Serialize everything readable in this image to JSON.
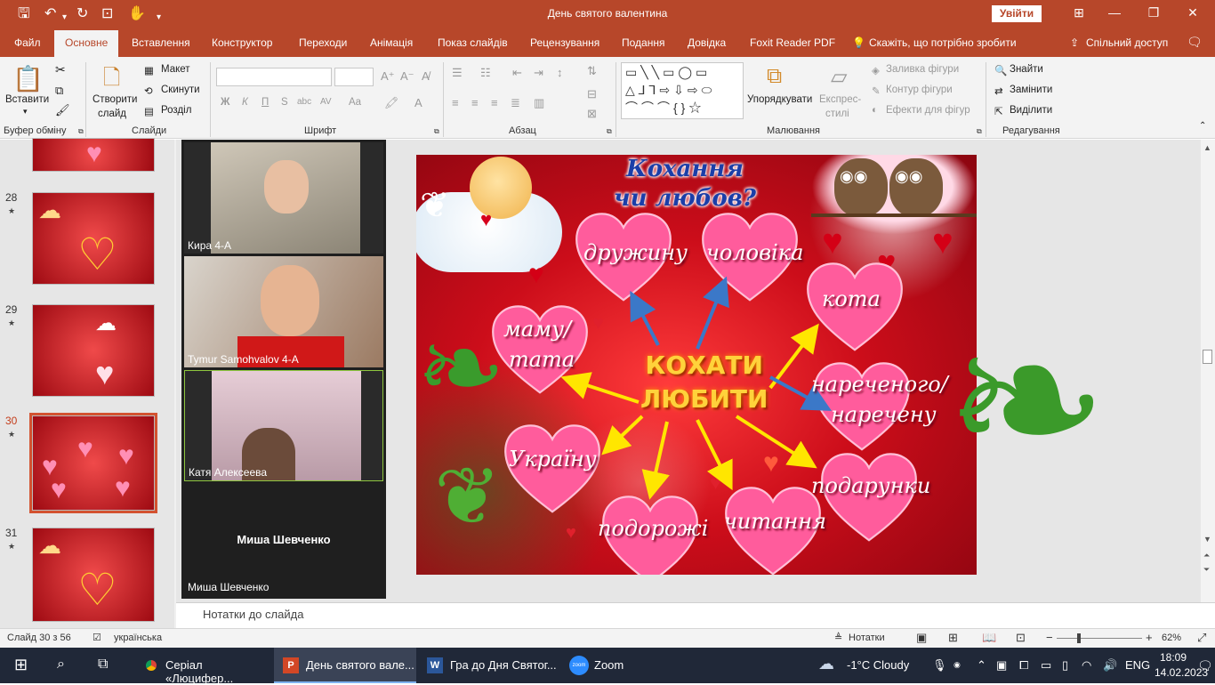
{
  "window": {
    "title": "День святого валентина",
    "signin": "Увійти"
  },
  "tabs": [
    "Файл",
    "Основне",
    "Вставлення",
    "Конструктор",
    "Переходи",
    "Анімація",
    "Показ слайдів",
    "Рецензування",
    "Подання",
    "Довідка",
    "Foxit Reader PDF"
  ],
  "tell_me": "Скажіть, що потрібно зробити",
  "share": "Спільний доступ",
  "ribbon": {
    "clipboard": {
      "paste": "Вставити",
      "group": "Буфер обміну"
    },
    "slides": {
      "new": "Створити",
      "new2": "слайд",
      "layout": "Макет",
      "reset": "Скинути",
      "section": "Розділ",
      "group": "Слайди"
    },
    "font": {
      "group": "Шрифт",
      "bold": "Ж",
      "italic": "К",
      "underline": "П",
      "strike": "S",
      "shadow": "abc",
      "spacing": "AV",
      "case": "Aa"
    },
    "paragraph": {
      "group": "Абзац"
    },
    "drawing": {
      "arrange": "Упорядкувати",
      "quick_styles": "Експрес-",
      "quick_styles2": "стилі",
      "fill": "Заливка фігури",
      "outline": "Контур фігури",
      "effects": "Ефекти для фігур",
      "group": "Малювання"
    },
    "editing": {
      "find": "Знайти",
      "replace": "Замінити",
      "select": "Виділити",
      "group": "Редагування"
    }
  },
  "thumbnails": [
    {
      "num": "28"
    },
    {
      "num": "29"
    },
    {
      "num": "30",
      "selected": true
    },
    {
      "num": "31"
    }
  ],
  "zoom": {
    "participants": [
      {
        "name": "Кира 4-А"
      },
      {
        "name": "Tymur Samohvalov 4-A"
      },
      {
        "name": "Катя Алексеева"
      },
      {
        "name": "Миша Шевченко",
        "center": "Миша Шевченко"
      }
    ]
  },
  "slide": {
    "title_line1": "Кохання",
    "title_line2": "чи любов?",
    "center_line1": "КОХАТИ",
    "center_line2": "ЛЮБИТИ",
    "words": {
      "druzhynu": "дружину",
      "cholovika": "чоловіка",
      "kota": "кота",
      "mamu1": "маму/",
      "mamu2": "тата",
      "narech1": "нареченого/",
      "narech2": "наречену",
      "ukrainu": "Україну",
      "podarunky": "подарунки",
      "podorozhi": "подорожі",
      "chytannia": "читання"
    }
  },
  "notes": "Нотатки до слайда",
  "status": {
    "slide": "Слайд 30 з 56",
    "lang": "українська",
    "notes_btn": "Нотатки",
    "zoom_minus": "−",
    "zoom_plus": "+",
    "zoom": "62%"
  },
  "taskbar": {
    "apps": [
      {
        "label": "Серіал «Люцифер...",
        "icon": "chrome-icon"
      },
      {
        "label": "День святого вале...",
        "icon": "powerpoint-icon",
        "active": true
      },
      {
        "label": "Гра до Дня Святог...",
        "icon": "word-icon"
      },
      {
        "label": "Zoom",
        "icon": "zoom-icon"
      }
    ],
    "weather": "-1°C  Cloudy",
    "lang": "ENG",
    "time": "18:09",
    "date": "14.02.2023"
  },
  "colors": {
    "accent": "#b7472a",
    "slide_bg": "#cc0d1a",
    "heart": "#ff5c9c",
    "arrow_yellow": "#ffe600",
    "arrow_blue": "#3b78c8"
  }
}
